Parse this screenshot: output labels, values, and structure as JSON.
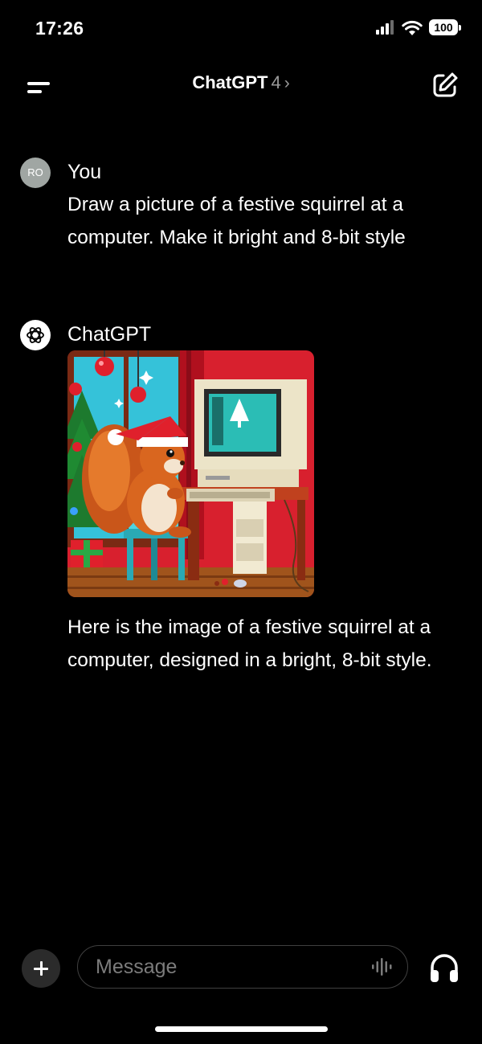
{
  "status_bar": {
    "time": "17:26",
    "battery": "100",
    "icons": [
      "cellular-signal-icon",
      "wifi-icon",
      "battery-icon"
    ]
  },
  "nav": {
    "title": "ChatGPT",
    "version": "4",
    "chevron": "›",
    "icons": {
      "menu": "menu-icon",
      "new_chat": "new-chat-icon"
    }
  },
  "conversation": {
    "user": {
      "avatar_initials": "RO",
      "name": "You",
      "text": "Draw a picture of a festive squirrel at a computer. Make it bright and 8-bit style"
    },
    "assistant": {
      "name": "ChatGPT",
      "image_icon": "generated-image-festive-squirrel-at-computer",
      "text": "Here is the image of a festive squirrel at a computer, designed in a bright, 8-bit style."
    }
  },
  "composer": {
    "placeholder": "Message",
    "icons": {
      "attach": "plus-icon",
      "voice": "voice-waveform-icon",
      "headphones": "headphones-icon"
    }
  },
  "colors": {
    "background": "#000000",
    "text": "#ffffff",
    "muted": "#9a9a9a",
    "user_avatar": "#a0a6a3",
    "input_border": "#3f3f3f"
  }
}
